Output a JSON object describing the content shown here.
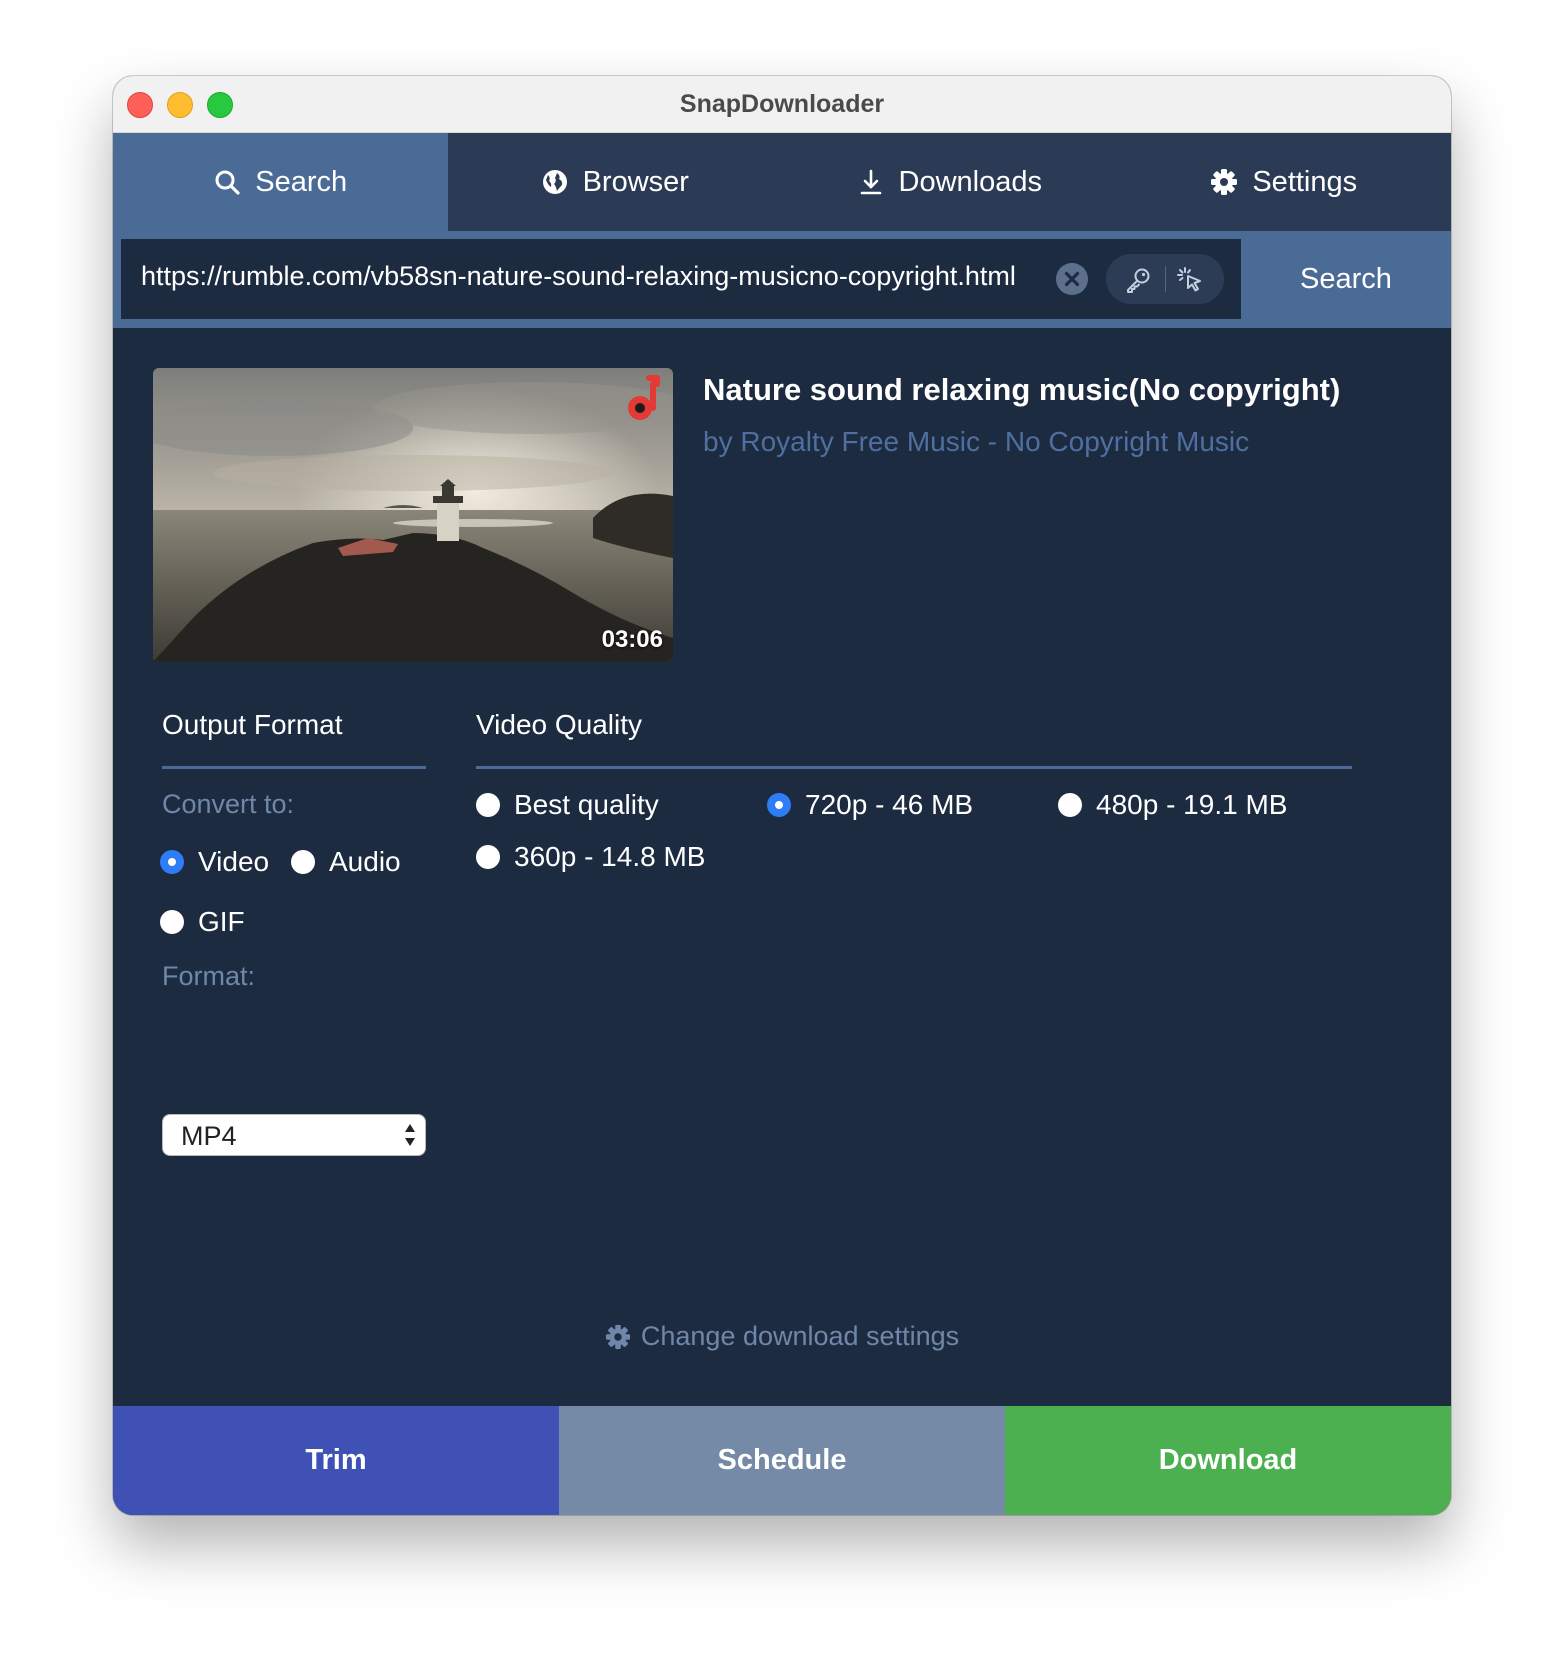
{
  "window": {
    "title": "SnapDownloader"
  },
  "tabs": [
    {
      "label": "Search",
      "icon": "search-icon",
      "active": true
    },
    {
      "label": "Browser",
      "icon": "globe-icon",
      "active": false
    },
    {
      "label": "Downloads",
      "icon": "download-icon",
      "active": false
    },
    {
      "label": "Settings",
      "icon": "gear-icon",
      "active": false
    }
  ],
  "url_bar": {
    "value": "https://rumble.com/vb58sn-nature-sound-relaxing-musicno-copyright.html",
    "clear_icon": "close-circle-icon",
    "tool_icons": [
      "key-icon",
      "cursor-click-icon"
    ],
    "search_label": "Search"
  },
  "video": {
    "title": "Nature sound relaxing music(No copyright)",
    "author": "by Royalty Free Music - No Copyright Music",
    "duration": "03:06",
    "badge_icon": "music-note-icon"
  },
  "output_format": {
    "heading": "Output Format",
    "convert_label": "Convert to:",
    "options": [
      {
        "label": "Video",
        "selected": true
      },
      {
        "label": "Audio",
        "selected": false
      },
      {
        "label": "GIF",
        "selected": false
      }
    ],
    "format_label": "Format:",
    "format_value": "MP4"
  },
  "video_quality": {
    "heading": "Video Quality",
    "options": [
      {
        "label": "Best quality",
        "selected": false
      },
      {
        "label": "720p - 46 MB",
        "selected": true
      },
      {
        "label": "480p - 19.1 MB",
        "selected": false
      },
      {
        "label": "360p - 14.8 MB",
        "selected": false
      }
    ]
  },
  "settings_link": {
    "label": "Change download settings",
    "icon": "gear-icon"
  },
  "actions": {
    "trim": "Trim",
    "schedule": "Schedule",
    "download": "Download"
  },
  "colors": {
    "panel_bg": "#1d2b40",
    "tab_bar": "#2c3b55",
    "tab_active": "#4a6b96",
    "link_muted": "#4f6fa0",
    "trim_bg": "#3f51b5",
    "schedule_bg": "#748aa6",
    "download_bg": "#4caf50",
    "radio_selected": "#2e7cf6"
  }
}
